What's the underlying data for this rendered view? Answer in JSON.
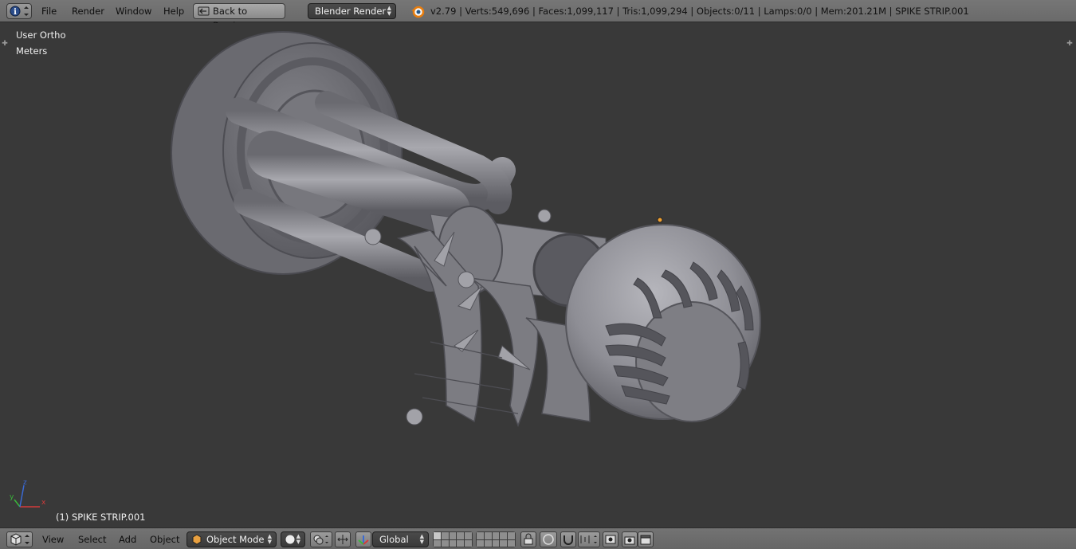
{
  "top": {
    "menus": [
      "File",
      "Render",
      "Window",
      "Help"
    ],
    "back_button": "Back to Previous",
    "render_engine": "Blender Render",
    "stats": "v2.79 | Verts:549,696 | Faces:1,099,117 | Tris:1,099,294 | Objects:0/11 | Lamps:0/0 | Mem:201.21M | SPIKE STRIP.001"
  },
  "viewport": {
    "view_name": "User Ortho",
    "units": "Meters",
    "active_object": "(1) SPIKE STRIP.001",
    "axes": {
      "x": "x",
      "y": "y",
      "z": "z"
    }
  },
  "bottom": {
    "menus": [
      "View",
      "Select",
      "Add",
      "Object"
    ],
    "mode": "Object Mode",
    "orientation": "Global"
  },
  "colors": {
    "header": "#6e6e6e",
    "viewport_bg": "#393939",
    "mesh": "#8d8d93",
    "origin": "#f0a030"
  }
}
